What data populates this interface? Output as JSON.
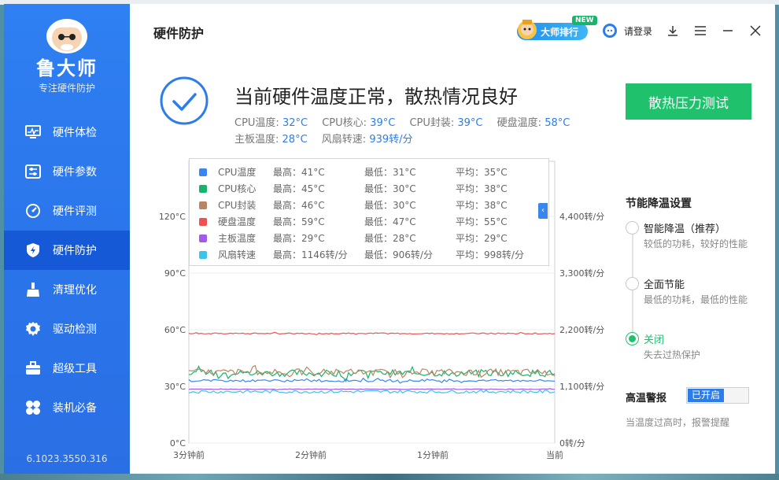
{
  "app": {
    "brand": "鲁大师",
    "slogan": "专注硬件防护",
    "version": "6.1023.3550.316"
  },
  "sidebar": {
    "items": [
      {
        "label": "硬件体检",
        "icon": "monitor-icon"
      },
      {
        "label": "硬件参数",
        "icon": "sliders-icon"
      },
      {
        "label": "硬件评测",
        "icon": "speedometer-icon"
      },
      {
        "label": "硬件防护",
        "icon": "shield-icon",
        "active": true
      },
      {
        "label": "清理优化",
        "icon": "broom-icon"
      },
      {
        "label": "驱动检测",
        "icon": "gear-icon"
      },
      {
        "label": "超级工具",
        "icon": "toolbox-icon"
      },
      {
        "label": "装机必备",
        "icon": "grid-icon"
      }
    ]
  },
  "header": {
    "title": "硬件防护",
    "rank_label": "大师排行",
    "new_badge": "NEW",
    "login_label": "请登录"
  },
  "status": {
    "title": "当前硬件温度正常，散热情况良好",
    "readings": [
      {
        "label": "CPU温度:",
        "value": "32°C"
      },
      {
        "label": "CPU核心:",
        "value": "39°C"
      },
      {
        "label": "CPU封装:",
        "value": "39°C"
      },
      {
        "label": "硬盘温度:",
        "value": "58°C"
      },
      {
        "label": "主板温度:",
        "value": "28°C"
      },
      {
        "label": "风扇转速:",
        "value": "939转/分"
      }
    ],
    "stress_button": "散热压力测试"
  },
  "legend": {
    "rows": [
      {
        "name": "CPU温度",
        "max": "最高：41°C",
        "min": "最低：31°C",
        "avg": "平均：35°C",
        "color": "#3a86f0"
      },
      {
        "name": "CPU核心",
        "max": "最高：45°C",
        "min": "最低：30°C",
        "avg": "平均：38°C",
        "color": "#16b46a"
      },
      {
        "name": "CPU封装",
        "max": "最高：46°C",
        "min": "最低：30°C",
        "avg": "平均：38°C",
        "color": "#b98664"
      },
      {
        "name": "硬盘温度",
        "max": "最高：59°C",
        "min": "最低：47°C",
        "avg": "平均：55°C",
        "color": "#ef5151"
      },
      {
        "name": "主板温度",
        "max": "最高：29°C",
        "min": "最低：28°C",
        "avg": "平均：29°C",
        "color": "#a25be8"
      },
      {
        "name": "风扇转速",
        "max": "最高：1146转/分",
        "min": "最低：906转/分",
        "avg": "平均：998转/分",
        "color": "#3cc3ec"
      }
    ],
    "collapse_glyph": "‹"
  },
  "chart_data": {
    "type": "line",
    "x_ticks": [
      "3分钟前",
      "2分钟前",
      "1分钟前",
      "当前"
    ],
    "y_left_ticks": [
      "0°C",
      "30°C",
      "60°C",
      "90°C",
      "120°C"
    ],
    "y_left_range": [
      0,
      120
    ],
    "y_right_ticks": [
      "0转/分",
      "1,100转/分",
      "2,200转/分",
      "3,300转/分",
      "4,400转/分"
    ],
    "y_right_range": [
      0,
      4400
    ],
    "series": [
      {
        "name": "硬盘温度",
        "color": "#ef5151",
        "baseline": 58,
        "noise": 0.6
      },
      {
        "name": "CPU核心",
        "color": "#16b46a",
        "baseline": 37,
        "noise": 3.5
      },
      {
        "name": "CPU封装",
        "color": "#b98664",
        "baseline": 37.5,
        "noise": 3.5
      },
      {
        "name": "CPU温度",
        "color": "#3a86f0",
        "baseline": 33,
        "noise": 1.2
      },
      {
        "name": "主板温度",
        "color": "#a25be8",
        "baseline": 28.5,
        "noise": 0.3
      },
      {
        "name": "风扇转速",
        "color": "#3cc3ec",
        "baseline_rpm": 998,
        "noise_rpm": 30,
        "axis": "right"
      }
    ]
  },
  "energy": {
    "title": "节能降温设置",
    "options": [
      {
        "label": "智能降温（推荐）",
        "desc": "较低的功耗，较好的性能",
        "checked": false
      },
      {
        "label": "全面节能",
        "desc": "最低的功耗，最低的性能",
        "checked": false
      },
      {
        "label": "关闭",
        "desc": "失去过热保护",
        "checked": true
      }
    ]
  },
  "alarm": {
    "title": "高温警报",
    "toggle_label": "已开启",
    "desc": "当温度过高时，报警提醒"
  }
}
